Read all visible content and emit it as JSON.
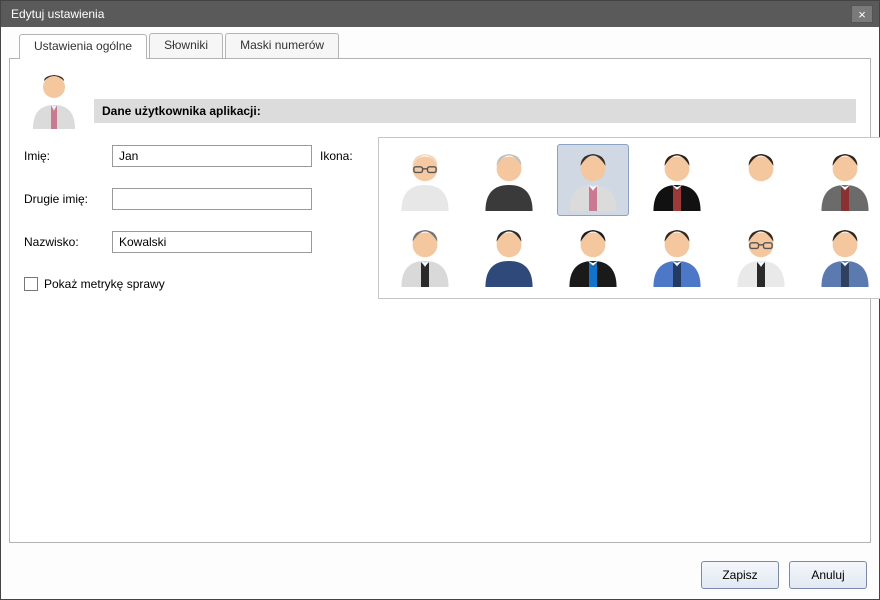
{
  "window": {
    "title": "Edytuj ustawienia"
  },
  "tabs": {
    "general": "Ustawienia ogólne",
    "dict": "Słowniki",
    "masks": "Maski numerów"
  },
  "section": {
    "header": "Dane użytkownika aplikacji:"
  },
  "labels": {
    "first_name": "Imię:",
    "middle_name": "Drugie imię:",
    "last_name": "Nazwisko:",
    "icon": "Ikona:",
    "show_metrics": "Pokaż metrykę sprawy"
  },
  "values": {
    "first_name": "Jan",
    "middle_name": "",
    "last_name": "Kowalski",
    "show_metrics_checked": false
  },
  "avatars": {
    "selected_index": 2,
    "items": [
      {
        "hair": "#f2d9b9",
        "skin": "#f6c9a2",
        "top": "#e7e7e7",
        "tie": null,
        "glasses": true
      },
      {
        "hair": "#bfbfbf",
        "skin": "#f4c79e",
        "top": "#3a3a3a",
        "tie": null,
        "glasses": false
      },
      {
        "hair": "#3a2e28",
        "skin": "#f4c79e",
        "top": "#dbdbdb",
        "tie": "#c97a92",
        "glasses": false
      },
      {
        "hair": "#2c2219",
        "skin": "#f4c79e",
        "top": "#111111",
        "tie": "#9c3a3a",
        "glasses": false
      },
      {
        "hair": "#2f251d",
        "skin": "#f4c79e",
        "top": "#ffffff",
        "tie": null,
        "glasses": false
      },
      {
        "hair": "#2e241c",
        "skin": "#f4c79e",
        "top": "#6b6b6b",
        "tie": "#8a3030",
        "glasses": false
      },
      {
        "hair": "#747474",
        "skin": "#f4c79e",
        "top": "#d9d9d9",
        "tie": "#2a2a2a",
        "glasses": false
      },
      {
        "hair": "#2a2a2a",
        "skin": "#f4c79e",
        "top": "#2f497a",
        "tie": null,
        "glasses": false
      },
      {
        "hair": "#1c1c1c",
        "skin": "#f4c79e",
        "top": "#1a1a1a",
        "tie": "#1173c9",
        "glasses": false
      },
      {
        "hair": "#33281f",
        "skin": "#f4c79e",
        "top": "#4d78c7",
        "tie": "#233a63",
        "glasses": false
      },
      {
        "hair": "#362a20",
        "skin": "#f4c79e",
        "top": "#e9e9e9",
        "tie": "#2a2a2a",
        "glasses": true
      },
      {
        "hair": "#2e241c",
        "skin": "#f4c79e",
        "top": "#5a7ab0",
        "tie": "#30415f",
        "glasses": false
      }
    ]
  },
  "buttons": {
    "save": "Zapisz",
    "cancel": "Anuluj"
  }
}
